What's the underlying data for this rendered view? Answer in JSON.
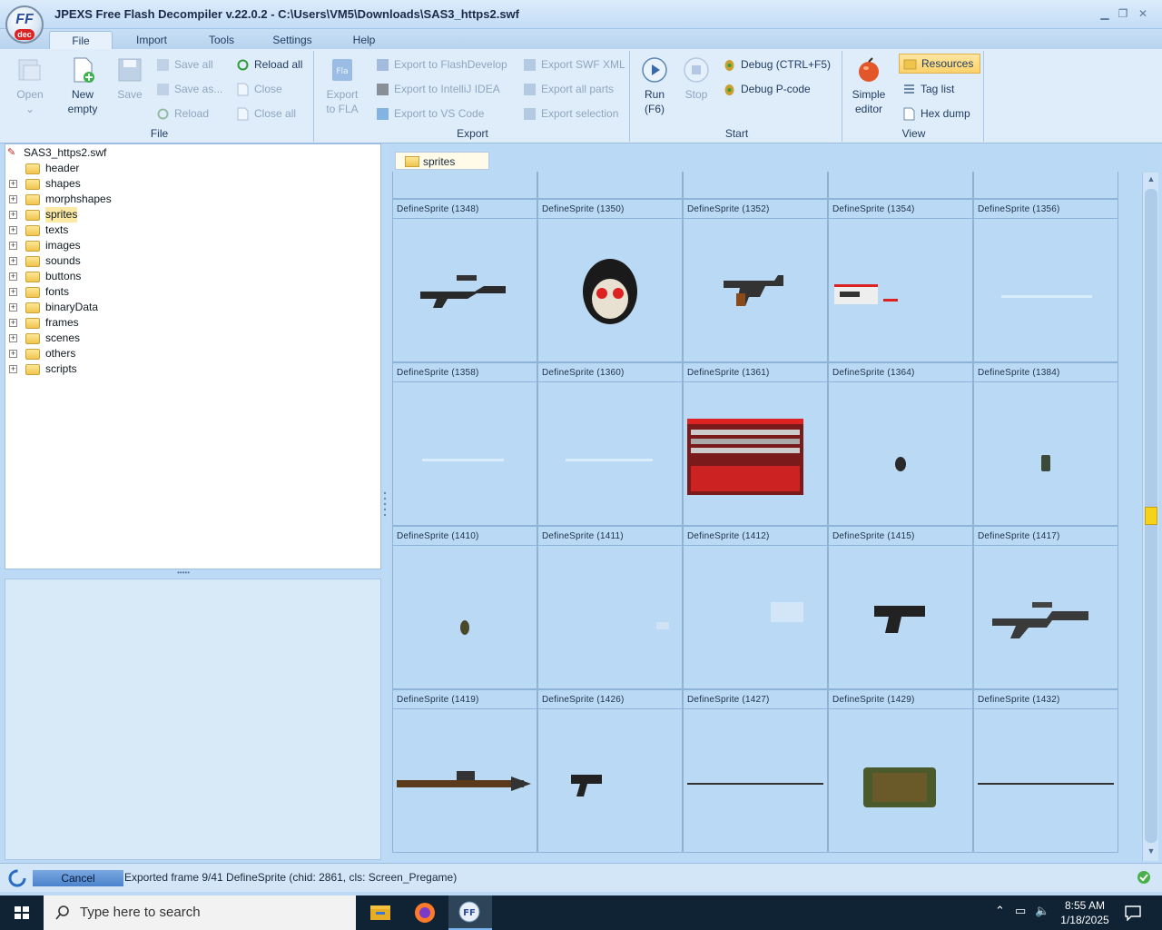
{
  "window": {
    "title": "JPEXS Free Flash Decompiler v.22.0.2 - C:\\Users\\VM5\\Downloads\\SAS3_https2.swf",
    "logo_text": "FF",
    "logo_sub": "dec"
  },
  "menu": {
    "tabs": [
      "File",
      "Import",
      "Tools",
      "Settings",
      "Help"
    ]
  },
  "ribbon": {
    "file": {
      "label": "File",
      "open": "Open",
      "new_line1": "New",
      "new_line2": "empty",
      "save": "Save",
      "save_all": "Save all",
      "save_as": "Save as...",
      "reload": "Reload",
      "reload_all": "Reload all",
      "close": "Close",
      "close_all": "Close all"
    },
    "export": {
      "label": "Export",
      "export_fla_1": "Export",
      "export_fla_2": "to FLA",
      "flashdevelop": "Export to FlashDevelop",
      "intellij": "Export to IntelliJ IDEA",
      "vscode": "Export to VS Code",
      "swf_xml": "Export SWF XML",
      "all_parts": "Export all parts",
      "selection": "Export selection"
    },
    "start": {
      "label": "Start",
      "run_1": "Run",
      "run_2": "(F6)",
      "stop": "Stop",
      "debug": "Debug (CTRL+F5)",
      "debug_pcode": "Debug P-code"
    },
    "view": {
      "label": "View",
      "simple_1": "Simple",
      "simple_2": "editor",
      "resources": "Resources",
      "tag_list": "Tag list",
      "hex_dump": "Hex dump"
    }
  },
  "tree": {
    "root": "SAS3_https2.swf",
    "items": [
      "header",
      "shapes",
      "morphshapes",
      "sprites",
      "texts",
      "images",
      "sounds",
      "buttons",
      "fonts",
      "binaryData",
      "frames",
      "scenes",
      "others",
      "scripts"
    ],
    "selected": "sprites"
  },
  "content": {
    "tab": "sprites",
    "cells": [
      "DefineSprite (1348)",
      "DefineSprite (1350)",
      "DefineSprite (1352)",
      "DefineSprite (1354)",
      "DefineSprite (1356)",
      "DefineSprite (1358)",
      "DefineSprite (1360)",
      "DefineSprite (1361)",
      "DefineSprite (1364)",
      "DefineSprite (1384)",
      "DefineSprite (1410)",
      "DefineSprite (1411)",
      "DefineSprite (1412)",
      "DefineSprite (1415)",
      "DefineSprite (1417)",
      "DefineSprite (1419)",
      "DefineSprite (1426)",
      "DefineSprite (1427)",
      "DefineSprite (1429)",
      "DefineSprite (1432)"
    ]
  },
  "status": {
    "cancel": "Cancel",
    "message": "Exported frame 9/41 DefineSprite (chid: 2861, cls: Screen_Pregame)"
  },
  "taskbar": {
    "search_placeholder": "Type here to search",
    "time": "8:55 AM",
    "date": "1/18/2025"
  },
  "colors": {
    "accent": "#2a6bc4",
    "selection": "#fbe9a4",
    "panel": "#bad9f5"
  }
}
